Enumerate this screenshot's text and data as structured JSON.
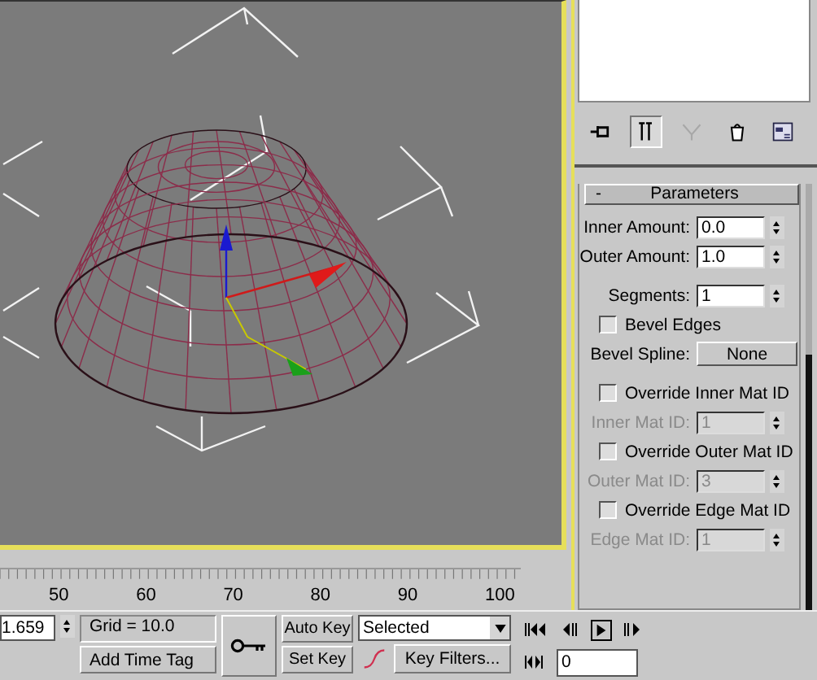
{
  "command_panel": {
    "tool_buttons": [
      {
        "kind": "pin",
        "selected": false,
        "disabled": false
      },
      {
        "kind": "end-result",
        "selected": true,
        "disabled": false
      },
      {
        "kind": "unique",
        "selected": false,
        "disabled": true
      },
      {
        "kind": "remove",
        "selected": false,
        "disabled": false
      },
      {
        "kind": "configure",
        "selected": false,
        "disabled": false
      }
    ],
    "rollout": {
      "toggle": "-",
      "title": "Parameters",
      "expanded": true,
      "groups": [
        [
          {
            "kind": "spinner",
            "label": "Inner Amount:",
            "value": "0.0",
            "disabled": false
          },
          {
            "kind": "spinner",
            "label": "Outer Amount:",
            "value": "1.0",
            "disabled": false
          }
        ],
        [
          {
            "kind": "spinner",
            "label": "Segments:",
            "value": "1",
            "disabled": false
          },
          {
            "kind": "checkbox",
            "label": "Bevel Edges",
            "checked": false
          },
          {
            "kind": "button",
            "label": "Bevel Spline:",
            "value": "None"
          }
        ],
        [
          {
            "kind": "checkbox",
            "label": "Override Inner Mat ID",
            "checked": false
          },
          {
            "kind": "spinner",
            "label": "Inner Mat ID:",
            "value": "1",
            "disabled": true
          },
          {
            "kind": "checkbox",
            "label": "Override Outer Mat ID",
            "checked": false
          },
          {
            "kind": "spinner",
            "label": "Outer Mat ID:",
            "value": "3",
            "disabled": true
          },
          {
            "kind": "checkbox",
            "label": "Override Edge Mat ID",
            "checked": false
          },
          {
            "kind": "spinner",
            "label": "Edge Mat ID:",
            "value": "1",
            "disabled": true
          }
        ]
      ]
    }
  },
  "timeline": {
    "labels": [
      "50",
      "60",
      "70",
      "80",
      "90",
      "100"
    ]
  },
  "status_bar": {
    "coordinate": "1.659",
    "grid": "Grid = 10.0",
    "add_time_tag": "Add Time Tag",
    "auto_key": "Auto Key",
    "set_key": "Set Key",
    "key_mode": "Selected",
    "key_filters": "Key Filters...",
    "frame": "0",
    "playing": false
  }
}
